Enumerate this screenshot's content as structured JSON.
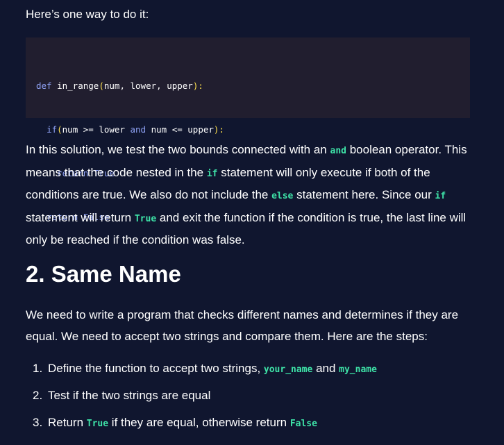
{
  "intro": "Here’s one way to do it:",
  "code": {
    "line1": {
      "kw": "def",
      "fn": "in_range",
      "open": "(",
      "a1": "num",
      "c1": ", ",
      "a2": "lower",
      "c2": ", ",
      "a3": "upper",
      "close": "):"
    },
    "line2": {
      "indent": "  ",
      "kw": "if",
      "open": "(",
      "t1": "num >= lower ",
      "op": "and",
      "t2": " num <= upper",
      "close": "):"
    },
    "line3": {
      "indent": "    ",
      "kw": "return",
      "sp": " ",
      "val": "True"
    },
    "line4": {
      "indent": "  ",
      "kw": "return",
      "sp": " ",
      "val": "False"
    }
  },
  "paragraph": {
    "p1": "In this solution, we test the two bounds connected with an ",
    "c1": "and",
    "p2": " boolean operator. This means that the code nested in the ",
    "c2": "if",
    "p3": " statement will only execute if both of the conditions are true. We also do not include the ",
    "c3": "else",
    "p4": " statement here. Since our ",
    "c4": "if",
    "p5": " statement will return ",
    "c5": "True",
    "p6": " and exit the function if the condition is true, the last line will only be reached if the condition was false."
  },
  "heading": "2. Same Name",
  "paragraph2": "We need to write a program that checks different names and determines if they are equal. We need to accept two strings and compare them. Here are the steps:",
  "steps": [
    {
      "num": "1.",
      "t1": "Define the function to accept two strings, ",
      "c1": "your_name",
      "t2": " and ",
      "c2": "my_name"
    },
    {
      "num": "2.",
      "t1": "Test if the two strings are equal"
    },
    {
      "num": "3.",
      "t1": "Return ",
      "c1": "True",
      "t2": " if they are equal, otherwise return ",
      "c2": "False"
    }
  ]
}
